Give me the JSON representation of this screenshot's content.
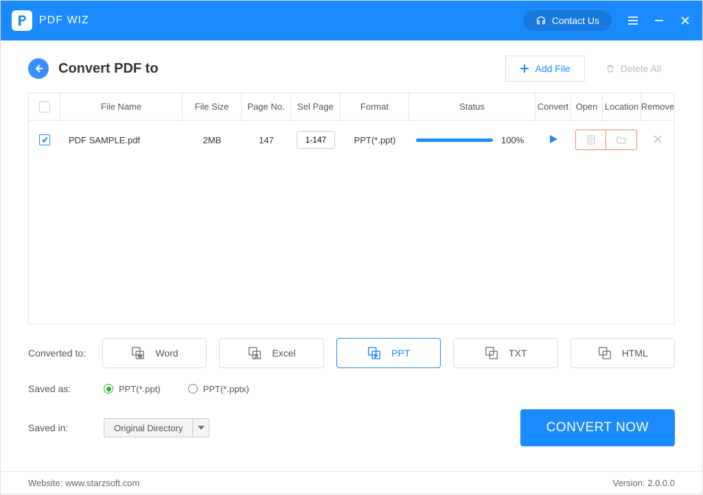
{
  "app": {
    "title": "PDF WIZ"
  },
  "titlebar": {
    "contact": "Contact Us"
  },
  "header": {
    "title": "Convert PDF to",
    "add_file": "Add File",
    "delete_all": "Delete All"
  },
  "table": {
    "cols": {
      "name": "File Name",
      "size": "File Size",
      "page": "Page No.",
      "sel": "Sel Page",
      "fmt": "Format",
      "status": "Status",
      "conv": "Convert",
      "open": "Open",
      "loc": "Location",
      "rem": "Remove"
    },
    "rows": [
      {
        "name": "PDF SAMPLE.pdf",
        "size": "2MB",
        "page": "147",
        "sel": "1-147",
        "fmt": "PPT(*.ppt)",
        "progress": 100,
        "percent": "100%"
      }
    ]
  },
  "formats": {
    "label": "Converted to:",
    "items": [
      "Word",
      "Excel",
      "PPT",
      "TXT",
      "HTML"
    ],
    "active": 2
  },
  "saved_as": {
    "label": "Saved as:",
    "options": [
      "PPT(*.ppt)",
      "PPT(*.pptx)"
    ],
    "selected": 0
  },
  "saved_in": {
    "label": "Saved in:",
    "value": "Original Directory"
  },
  "convert_btn": "CONVERT NOW",
  "footer": {
    "website_label": "Website:",
    "website_value": "www.starzsoft.com",
    "version_label": "Version:",
    "version_value": "2.0.0.0"
  }
}
